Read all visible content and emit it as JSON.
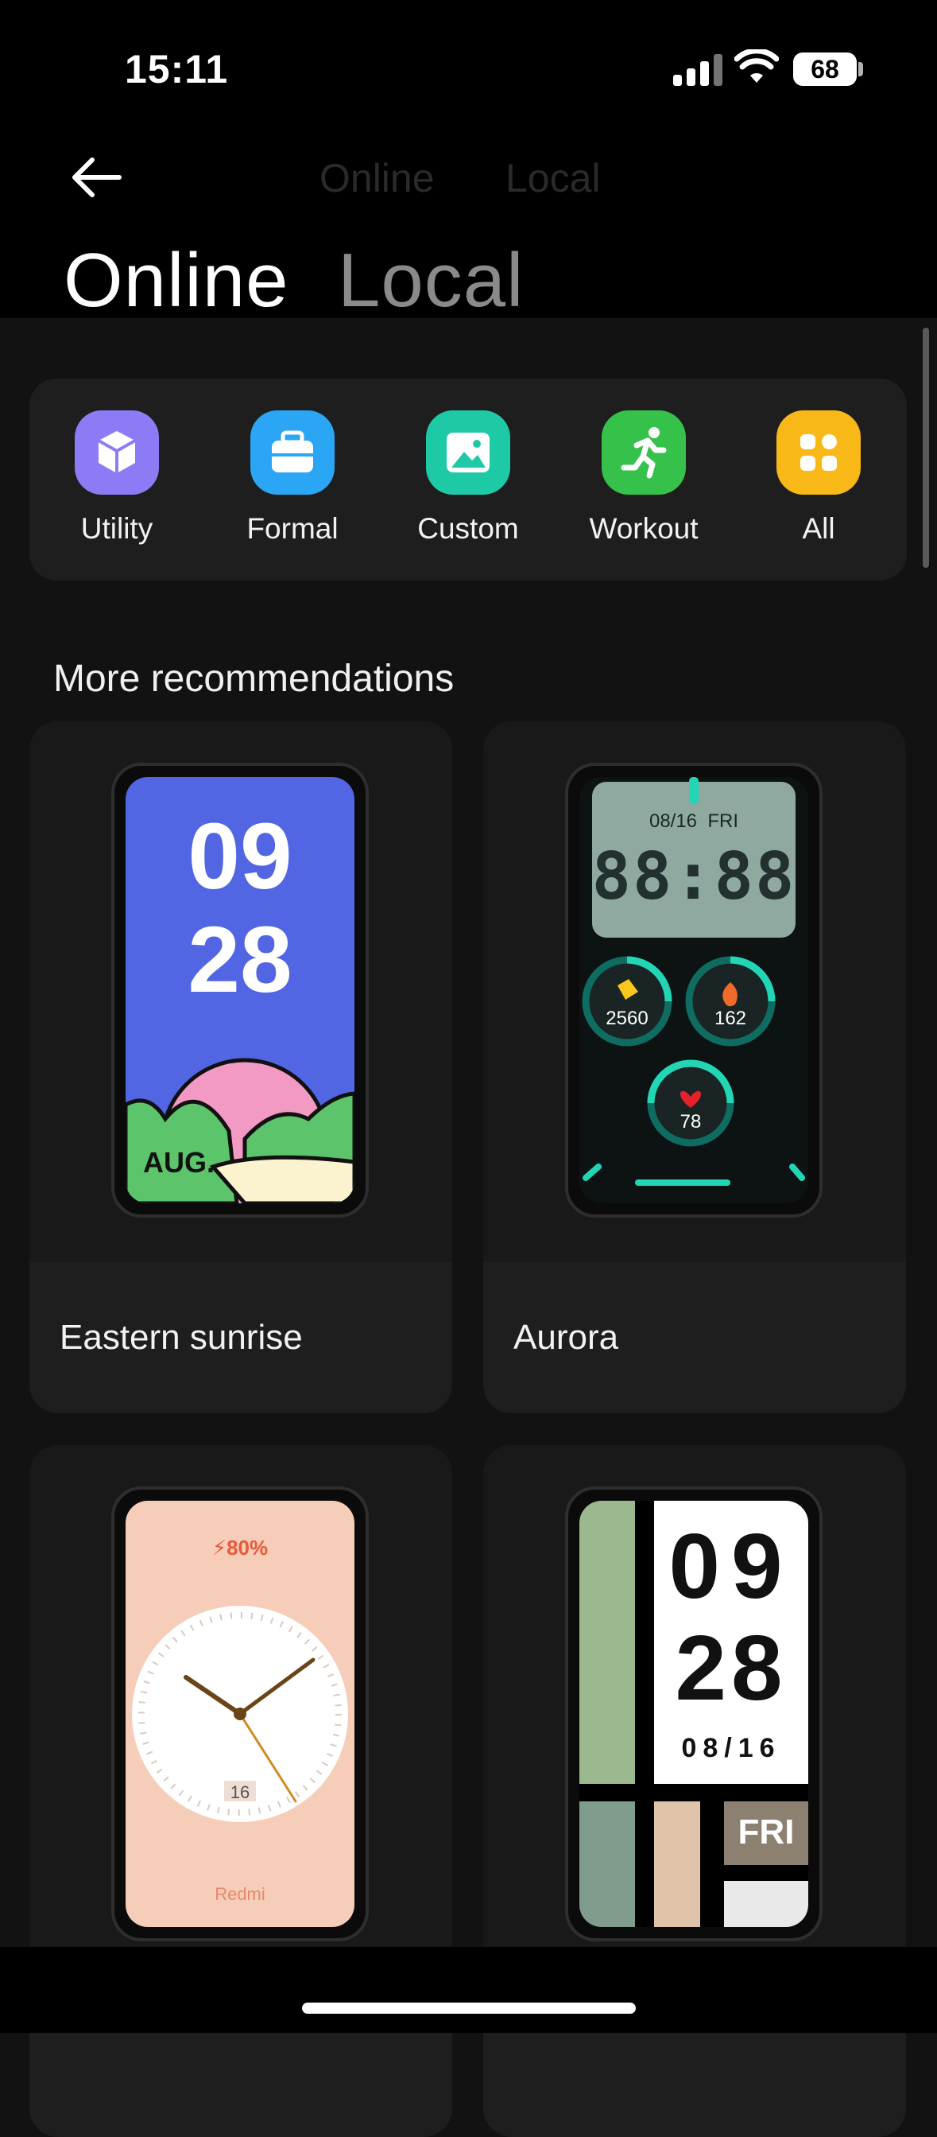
{
  "status_bar": {
    "time": "15:11",
    "battery": "68"
  },
  "header": {
    "tabs": [
      {
        "label": "Online",
        "active": true
      },
      {
        "label": "Local",
        "active": false
      }
    ]
  },
  "categories": [
    {
      "label": "Utility",
      "icon": "cube-icon",
      "color": "#8b7cf6"
    },
    {
      "label": "Formal",
      "icon": "briefcase-icon",
      "color": "#2aa6f5"
    },
    {
      "label": "Custom",
      "icon": "image-icon",
      "color": "#1ec9a6"
    },
    {
      "label": "Workout",
      "icon": "running-icon",
      "color": "#36c24a"
    },
    {
      "label": "All",
      "icon": "grid-icon",
      "color": "#f8b818"
    }
  ],
  "section_title": "More recommendations",
  "cards": [
    {
      "name": "Eastern sunrise",
      "face": {
        "hour": "09",
        "minute": "28",
        "month": "AUG."
      }
    },
    {
      "name": "Aurora",
      "face": {
        "date": "08/16  FRI",
        "digits": "88:88",
        "steps": "2560",
        "calories": "162",
        "heart": "78"
      }
    },
    {
      "name": "",
      "face": {
        "battery": "⚡80%",
        "day": "16",
        "brand": "Redmi"
      }
    },
    {
      "name": "",
      "face": {
        "hour": "09",
        "minute": "28",
        "date": "08/16",
        "weekday": "FRI"
      }
    }
  ]
}
